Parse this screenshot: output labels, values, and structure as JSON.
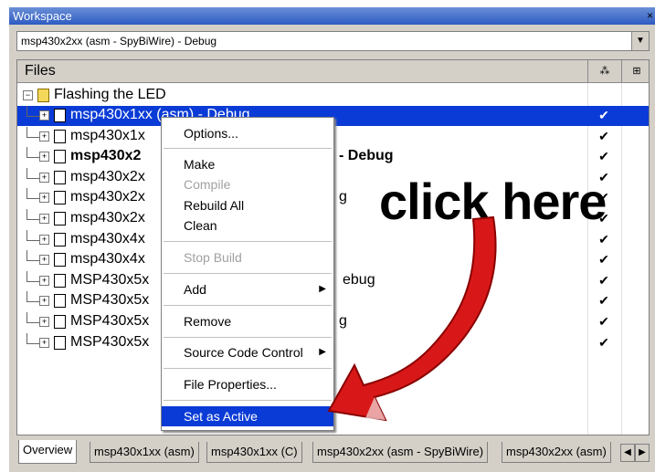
{
  "window": {
    "title": "Workspace",
    "close": "×"
  },
  "config_select": {
    "value": "msp430x2xx (asm - SpyBiWire) - Debug"
  },
  "header": {
    "files_label": "Files"
  },
  "tree": {
    "root": "Flashing the LED",
    "items": [
      {
        "label": "msp430x1xx (asm) - Debug",
        "selected": true,
        "bold": false
      },
      {
        "label": "msp430x1x",
        "bold": false
      },
      {
        "label": "msp430x2",
        "bold": true
      },
      {
        "label": "msp430x2x",
        "bold": false
      },
      {
        "label": "msp430x2x",
        "bold": false
      },
      {
        "label": "msp430x2x",
        "bold": false
      },
      {
        "label": "msp430x4x",
        "bold": false
      },
      {
        "label": "msp430x4x",
        "bold": false
      },
      {
        "label": "MSP430x5x",
        "bold": false
      },
      {
        "label": "MSP430x5x",
        "bold": false
      },
      {
        "label": "MSP430x5x",
        "bold": false
      },
      {
        "label": "MSP430x5x",
        "bold": false
      }
    ],
    "row3_suffix": "- Debug",
    "row5_suffix": "g",
    "row9_suffix": "ebug",
    "row11_suffix": "g",
    "check": "✔"
  },
  "context_menu": {
    "items": [
      {
        "label": "Options..."
      },
      {
        "label": "Make"
      },
      {
        "label": "Compile",
        "disabled": true
      },
      {
        "label": "Rebuild All"
      },
      {
        "label": "Clean"
      },
      {
        "label": "Stop Build",
        "disabled": true
      },
      {
        "label": "Add",
        "submenu": true
      },
      {
        "label": "Remove"
      },
      {
        "label": "Source Code Control",
        "submenu": true
      },
      {
        "label": "File Properties..."
      },
      {
        "label": "Set as Active",
        "highlighted": true
      }
    ]
  },
  "callout": {
    "text": "click here"
  },
  "tabs": [
    {
      "label": "Overview",
      "active": true
    },
    {
      "label": "msp430x1xx (asm)"
    },
    {
      "label": "msp430x1xx (C)"
    },
    {
      "label": "msp430x2xx (asm - SpyBiWire)"
    },
    {
      "label": "msp430x2xx (asm)"
    }
  ],
  "colors": {
    "selection": "#0a3bd6",
    "arrow": "#d81818"
  }
}
